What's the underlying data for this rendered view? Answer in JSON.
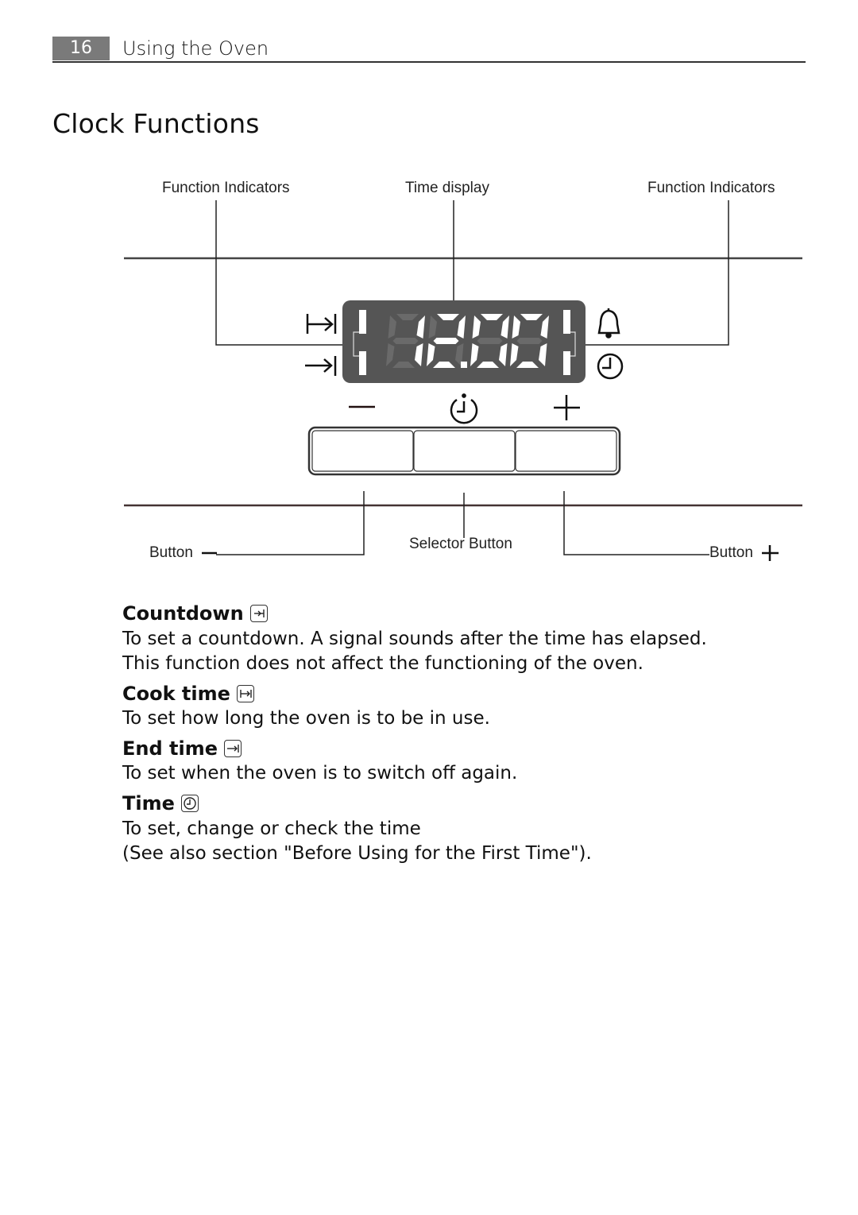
{
  "header": {
    "page_number": "16",
    "section": "Using the Oven"
  },
  "page_title": "Clock Functions",
  "diagram": {
    "labels": {
      "function_indicators_left": "Function Indicators",
      "time_display": "Time display",
      "function_indicators_right": "Function Indicators",
      "button_minus": "Button",
      "selector_button": "Selector Button",
      "button_plus": "Button"
    },
    "display_value": "12.00",
    "display_color": "#555555",
    "left_indicator_icons": [
      "cook-time-icon",
      "end-time-icon"
    ],
    "right_indicator_icons": [
      "bell-icon",
      "clock-icon"
    ],
    "button_symbols": [
      "minus",
      "selector-clock",
      "plus"
    ]
  },
  "entries": [
    {
      "title": "Countdown",
      "icon": "countdown-icon",
      "lines": [
        "To set a countdown. A signal sounds after the time has elapsed.",
        "This function does not affect the functioning of the oven."
      ]
    },
    {
      "title": "Cook time",
      "icon": "cook-time-icon",
      "lines": [
        "To set how long the oven is to be in use."
      ]
    },
    {
      "title": "End time",
      "icon": "end-time-icon",
      "lines": [
        "To set when the oven is to switch off again."
      ]
    },
    {
      "title": "Time",
      "icon": "clock-icon",
      "lines": [
        "To set, change or check the time",
        "(See also section \"Before Using for the First Time\")."
      ]
    }
  ]
}
